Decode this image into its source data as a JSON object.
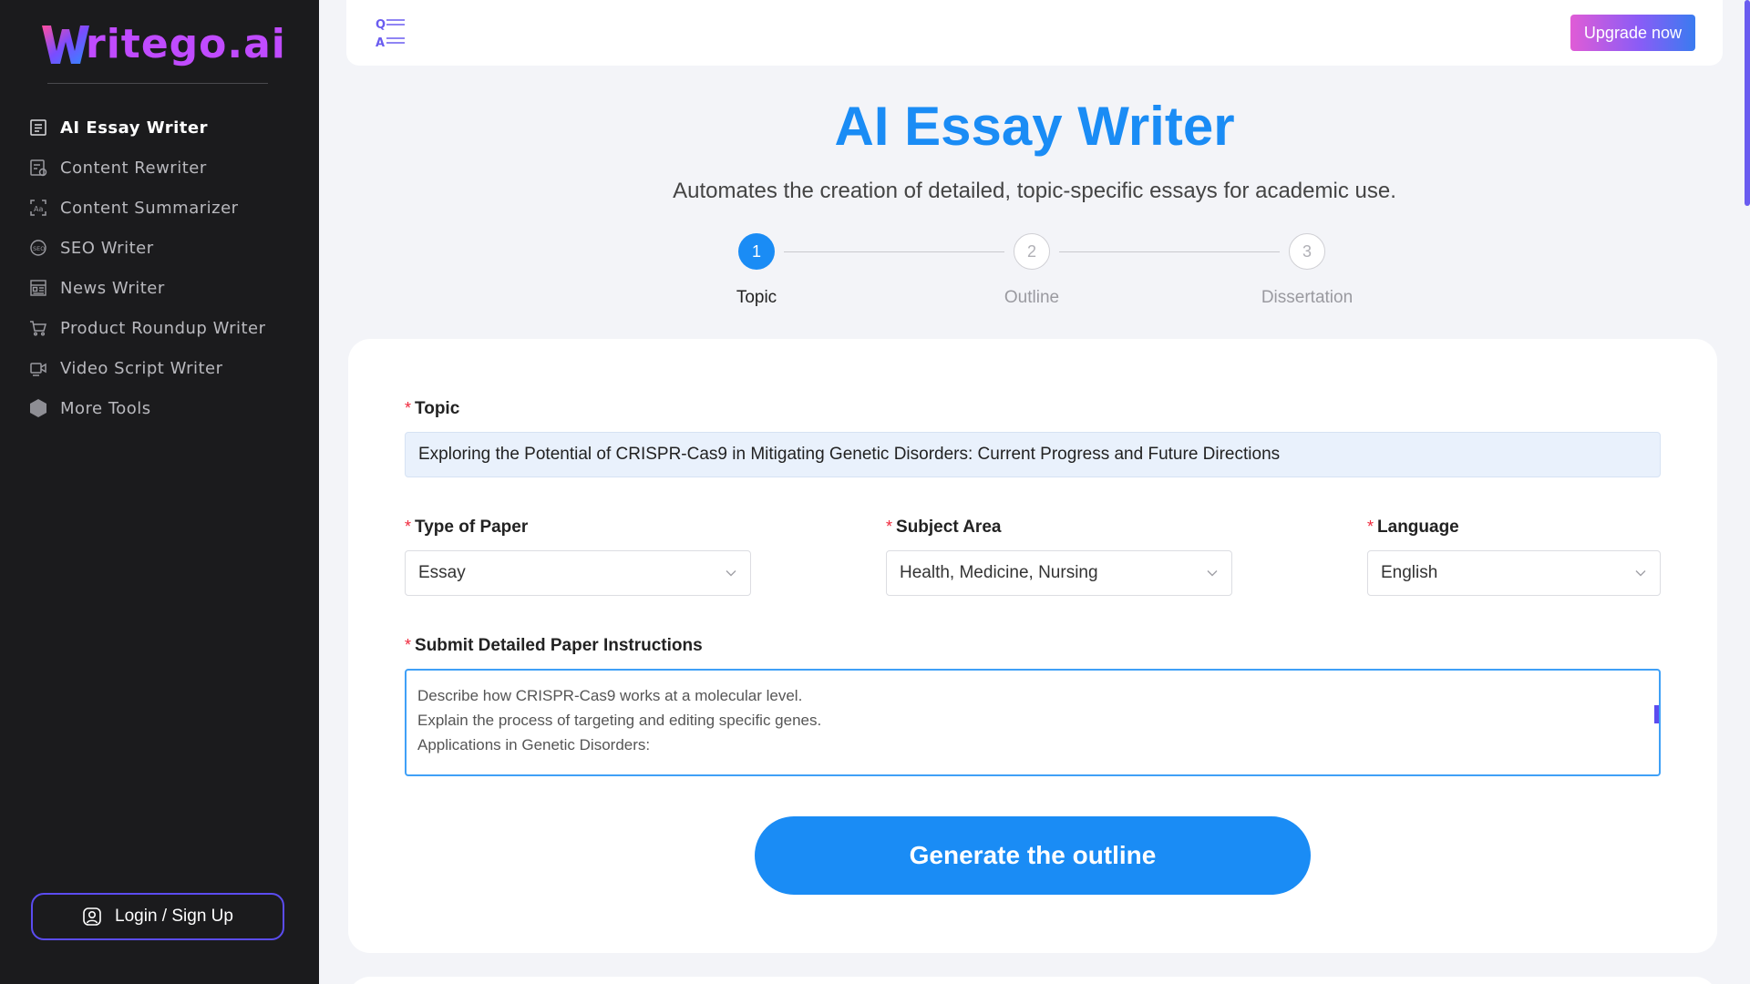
{
  "brand": {
    "logo_text": "ritego.ai",
    "logo_letter": "W"
  },
  "sidebar": {
    "items": [
      {
        "label": "AI Essay Writer",
        "icon": "essay-icon",
        "active": true
      },
      {
        "label": "Content Rewriter",
        "icon": "rewrite-icon",
        "active": false
      },
      {
        "label": "Content Summarizer",
        "icon": "summarize-icon",
        "active": false
      },
      {
        "label": "SEO Writer",
        "icon": "seo-icon",
        "active": false
      },
      {
        "label": "News Writer",
        "icon": "news-icon",
        "active": false
      },
      {
        "label": "Product Roundup Writer",
        "icon": "cart-icon",
        "active": false
      },
      {
        "label": "Video Script Writer",
        "icon": "video-icon",
        "active": false
      },
      {
        "label": "More Tools",
        "icon": "hexagon-icon",
        "active": false
      }
    ],
    "login_label": "Login / Sign Up"
  },
  "topbar": {
    "upgrade_label": "Upgrade now",
    "qa_q": "Q",
    "qa_a": "A"
  },
  "page": {
    "title": "AI Essay Writer",
    "subtitle": "Automates the creation of detailed, topic-specific essays for academic use."
  },
  "stepper": {
    "steps": [
      {
        "number": "1",
        "label": "Topic",
        "active": true
      },
      {
        "number": "2",
        "label": "Outline",
        "active": false
      },
      {
        "number": "3",
        "label": "Dissertation",
        "active": false
      }
    ]
  },
  "form": {
    "required_mark": "*",
    "topic": {
      "label": "Topic",
      "value": "Exploring the Potential of CRISPR-Cas9 in Mitigating Genetic Disorders: Current Progress and Future Directions"
    },
    "paper_type": {
      "label": "Type of Paper",
      "value": "Essay"
    },
    "subject_area": {
      "label": "Subject Area",
      "value": "Health, Medicine, Nursing"
    },
    "language": {
      "label": "Language",
      "value": "English"
    },
    "instructions": {
      "label": "Submit Detailed Paper Instructions",
      "lines": [
        "Describe how CRISPR-Cas9 works at a molecular level.",
        "Explain the process of targeting and editing specific genes.",
        "Applications in Genetic Disorders:"
      ]
    },
    "generate_label": "Generate the outline"
  },
  "colors": {
    "primary": "#1a8cf5",
    "sidebar_bg": "#1b1b1d",
    "accent_purple": "#5b4cf0",
    "required": "#f0283c"
  }
}
